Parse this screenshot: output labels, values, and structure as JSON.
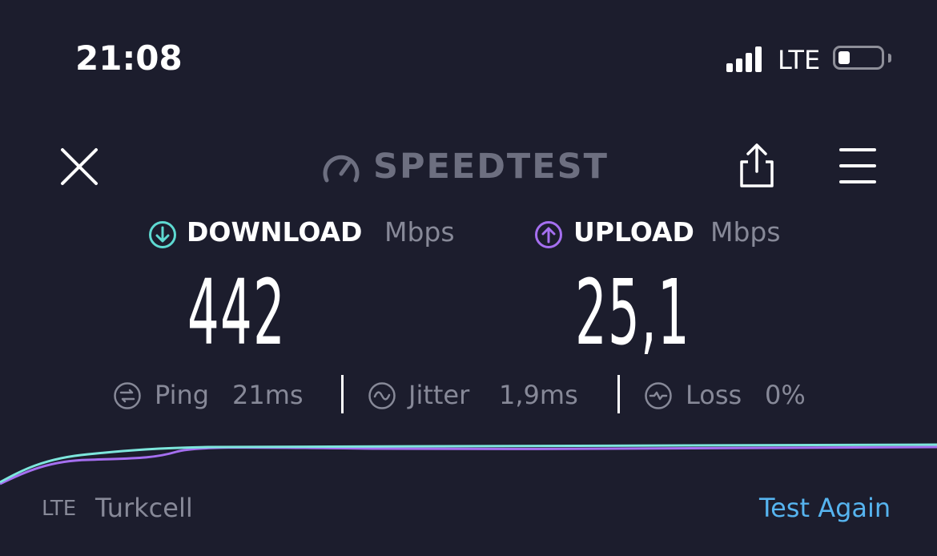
{
  "status_bar": {
    "time": "21:08",
    "network": "LTE",
    "icons": [
      "signal-icon",
      "battery-icon"
    ]
  },
  "header": {
    "logo_text": "SPEEDTEST",
    "icons": [
      "close-icon",
      "gauge-logo-icon",
      "share-icon",
      "menu-icon"
    ]
  },
  "download": {
    "label": "DOWNLOAD",
    "unit": "Mbps",
    "value": "442",
    "icon": "arrow-down-circle-icon",
    "color": "#5ed9d1"
  },
  "upload": {
    "label": "UPLOAD",
    "unit": "Mbps",
    "value": "25,1",
    "icon": "arrow-up-circle-icon",
    "color": "#a56ff0"
  },
  "metrics": {
    "ping": {
      "label": "Ping",
      "value": "21ms",
      "icon": "ping-icon"
    },
    "jitter": {
      "label": "Jitter",
      "value": "1,9ms",
      "icon": "jitter-icon"
    },
    "loss": {
      "label": "Loss",
      "value": "0%",
      "icon": "loss-icon"
    }
  },
  "footer": {
    "network": "LTE",
    "carrier": "Turkcell",
    "test_again": "Test Again",
    "link_color": "#56b4ef"
  }
}
